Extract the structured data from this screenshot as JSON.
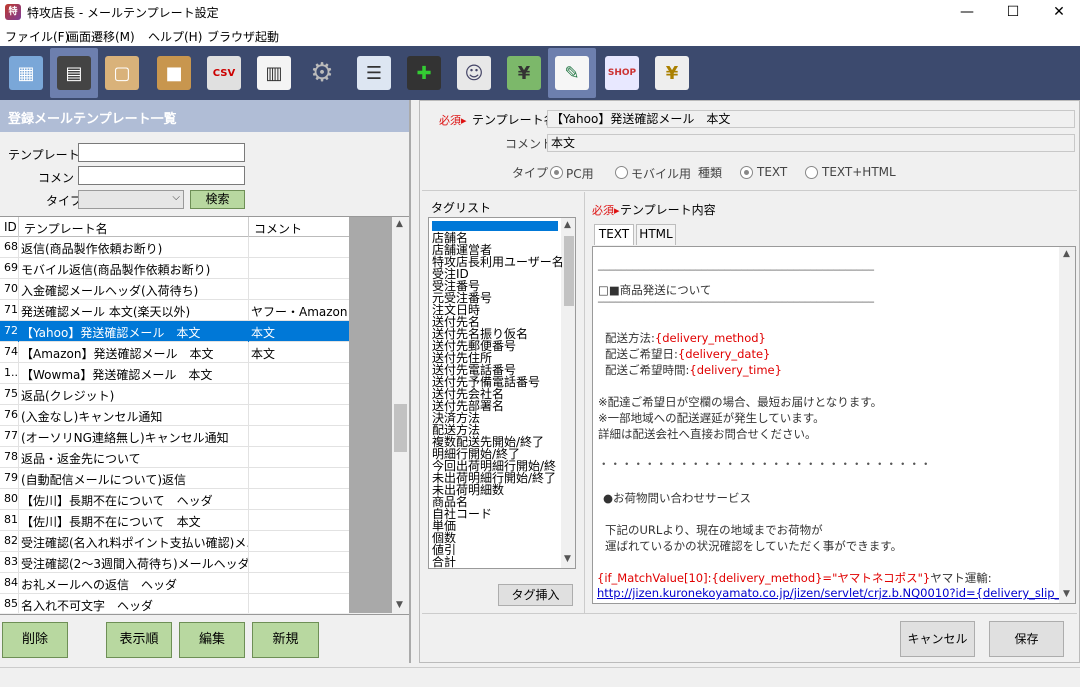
{
  "window": {
    "title": "特攻店長 - メールテンプレート設定",
    "app_icon": "特",
    "min": "—",
    "max": "☐",
    "close": "✕"
  },
  "menu": [
    "ファイル(F)",
    "画面遷移(M)",
    "ヘルプ(H)",
    "ブラウザ起動"
  ],
  "toolbar_icons": [
    "calendar-icon",
    "cash-register-icon",
    "shopping-bag-icon",
    "boxes-icon",
    "csv-download-icon",
    "spreadsheet-icon",
    "gear-icon",
    "report-icon",
    "printer-add-icon",
    "contact-card-icon",
    "cash-icon",
    "mail-template-edit-icon",
    "shop-window-icon",
    "receipt-icon"
  ],
  "left": {
    "header": "登録メールテンプレート一覧",
    "labels": {
      "name": "テンプレート名",
      "comment": "コメント",
      "type": "タイプ"
    },
    "search_button": "検索",
    "columns": {
      "id": "ID",
      "name": "テンプレート名",
      "comment": "コメント"
    },
    "rows": [
      {
        "id": "68",
        "name": "返信(商品製作依頼お断り)",
        "comment": ""
      },
      {
        "id": "69",
        "name": "モバイル返信(商品製作依頼お断り)",
        "comment": ""
      },
      {
        "id": "70",
        "name": "入金確認メールヘッダ(入荷待ち)",
        "comment": ""
      },
      {
        "id": "71",
        "name": "発送確認メール 本文(楽天以外)",
        "comment": "ヤフー・Amazon用"
      },
      {
        "id": "72",
        "name": "【Yahoo】発送確認メール　本文",
        "comment": "本文"
      },
      {
        "id": "74",
        "name": "【Amazon】発送確認メール　本文",
        "comment": "本文"
      },
      {
        "id": "1...",
        "name": "【Wowma】発送確認メール　本文",
        "comment": ""
      },
      {
        "id": "75",
        "name": "返品(クレジット)",
        "comment": ""
      },
      {
        "id": "76",
        "name": "(入金なし)キャンセル通知",
        "comment": ""
      },
      {
        "id": "77",
        "name": "(オーソリNG連絡無し)キャンセル通知",
        "comment": ""
      },
      {
        "id": "78",
        "name": "返品・返金先について",
        "comment": ""
      },
      {
        "id": "79",
        "name": "(自動配信メールについて)返信",
        "comment": ""
      },
      {
        "id": "80",
        "name": "【佐川】長期不在について　ヘッダ",
        "comment": ""
      },
      {
        "id": "81",
        "name": "【佐川】長期不在について　本文",
        "comment": ""
      },
      {
        "id": "82",
        "name": "受注確認(名入れ料ポイント支払い確認)メ...",
        "comment": ""
      },
      {
        "id": "83",
        "name": "受注確認(2〜3週間入荷待ち)メールヘッダ",
        "comment": ""
      },
      {
        "id": "84",
        "name": "お礼メールへの返信　ヘッダ",
        "comment": ""
      },
      {
        "id": "85",
        "name": "名入れ不可文字　ヘッダ",
        "comment": ""
      }
    ],
    "selected_index": 4,
    "buttons": {
      "delete": "削除",
      "order": "表示順",
      "edit": "編集",
      "new": "新規"
    }
  },
  "right": {
    "required": "必須",
    "template_name_label": "テンプレート名",
    "template_name_value": "【Yahoo】発送確認メール　本文",
    "comment_label": "コメント",
    "comment_value": "本文",
    "type_label": "タイプ",
    "type_options": [
      "PC用",
      "モバイル用"
    ],
    "kind_label": "種類",
    "kind_options": [
      "TEXT",
      "TEXT+HTML"
    ],
    "taglist_label": "タグリスト",
    "tags": [
      "店舗名",
      "店舗運営者",
      "特攻店長利用ユーザー名",
      "受注ID",
      "受注番号",
      "元受注番号",
      "注文日時",
      "送付先名",
      "送付先名振り仮名",
      "送付先郵便番号",
      "送付先住所",
      "送付先電話番号",
      "送付先予備電話番号",
      "送付先会社名",
      "送付先部署名",
      "決済方法",
      "配送方法",
      "複数配送先開始/終了",
      "明細行開始/終了",
      "今回出荷明細行開始/終",
      "未出荷明細行開始/終了",
      "未出荷明細数",
      "商品名",
      "自社コード",
      "単価",
      "個数",
      "値引",
      "合計"
    ],
    "tag_insert_button": "タグ挿入",
    "content_label": "テンプレート内容",
    "tabs": [
      "TEXT",
      "HTML"
    ],
    "content": {
      "rule": "________________________________________________",
      "heading": "□■商品発送について",
      "method_label": "配送方法:",
      "method_tag": "{delivery_method}",
      "date_label": "配送ご希望日:",
      "date_tag": "{delivery_date}",
      "time_label": "配送ご希望時間:",
      "time_tag": "{delivery_time}",
      "note1": "※配達ご希望日が空欄の場合、最短お届けとなります。",
      "note2": "※一部地域への配送遅延が発生しています。",
      "note3": "詳細は配送会社へ直接お問合せください。",
      "dots": "・・・・・・・・・・・・・・・・・・・・・・・・・・・・・",
      "service": "●お荷物問い合わせサービス",
      "svc1": "下記のURLより、現在の地域までお荷物が",
      "svc2": "運ばれているかの状況確認をしていただく事ができます。",
      "cond_tag": "{if_MatchValue[10]:{delivery_method}=\"ヤマトネコポス\"}",
      "cond_text": "ヤマト運輸:",
      "url": "http://jizen.kuronekoyamato.co.jp/jizen/servlet/crjz.b.NQ0010?id={delivery_slip_number}"
    },
    "buttons": {
      "cancel": "キャンセル",
      "save": "保存"
    }
  }
}
